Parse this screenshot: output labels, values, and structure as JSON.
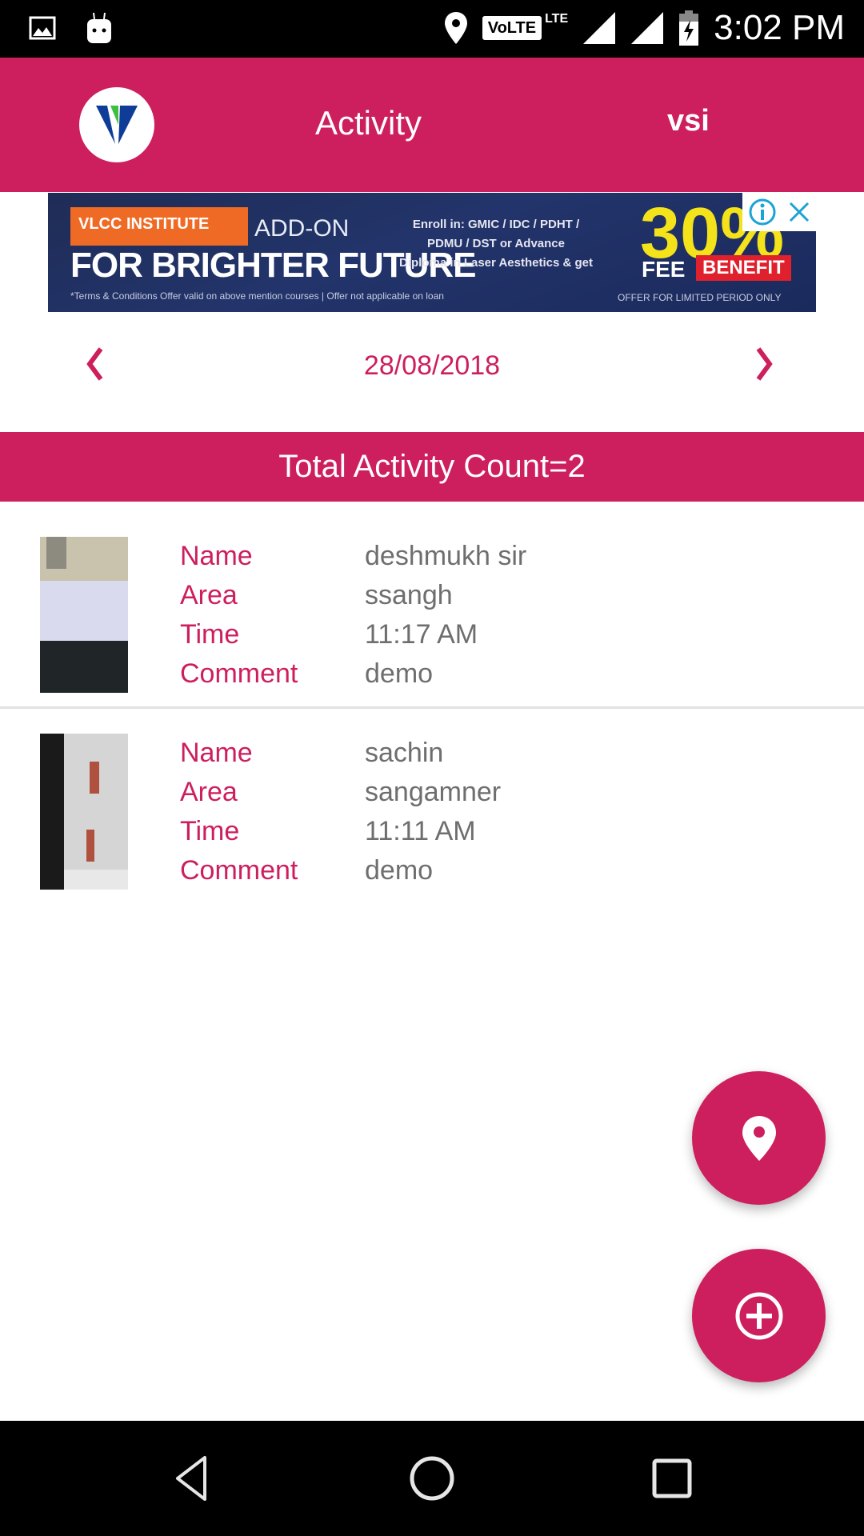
{
  "status_bar": {
    "time": "3:02 PM",
    "network_badge": "VoLTE",
    "network_type": "LTE",
    "icons": [
      "gallery-icon",
      "android-icon",
      "location-icon",
      "volte-icon",
      "signal-icon",
      "signal-icon",
      "battery-charging-icon"
    ]
  },
  "app_bar": {
    "title": "Activity",
    "user": "vsi",
    "logo": "vsi-logo"
  },
  "ad_banner": {
    "brand": "VLCC INSTITUTE",
    "addon": "ADD-ON",
    "headline": "FOR BRIGHTER FUTURE",
    "enroll_line1": "Enroll in: GMIC / IDC / PDHT /",
    "enroll_line2": "PDMU / DST or Advance",
    "enroll_line3": "Diploma in Laser Aesthetics & get",
    "percent": "30%",
    "fee": "FEE",
    "benefit": "BENEFIT",
    "terms": "*Terms & Conditions   Offer valid on above mention courses   |   Offer not applicable on loan",
    "limited": "OFFER FOR LIMITED PERIOD ONLY",
    "info_icon": "info-icon",
    "close_icon": "close-icon"
  },
  "date_nav": {
    "date": "28/08/2018",
    "prev_icon": "chevron-left-icon",
    "next_icon": "chevron-right-icon"
  },
  "summary": {
    "text": "Total Activity Count=2"
  },
  "labels": {
    "name": "Name",
    "area": "Area",
    "time": "Time",
    "comment": "Comment"
  },
  "activities": [
    {
      "name": "deshmukh sir",
      "area": "ssangh",
      "time": "11:17 AM",
      "comment": "demo",
      "thumbnail": "photo-laptop-screen"
    },
    {
      "name": "sachin",
      "area": "sangamner",
      "time": "11:11 AM",
      "comment": "demo",
      "thumbnail": "photo-monitor-screen"
    }
  ],
  "fabs": {
    "location": "location-pin-icon",
    "add": "add-circle-icon"
  },
  "nav_bar": {
    "back": "back-icon",
    "home": "home-icon",
    "recents": "recents-icon"
  },
  "colors": {
    "accent": "#cd1e5d",
    "value_text": "#6e6e6e",
    "divider": "#e2e2e2"
  }
}
